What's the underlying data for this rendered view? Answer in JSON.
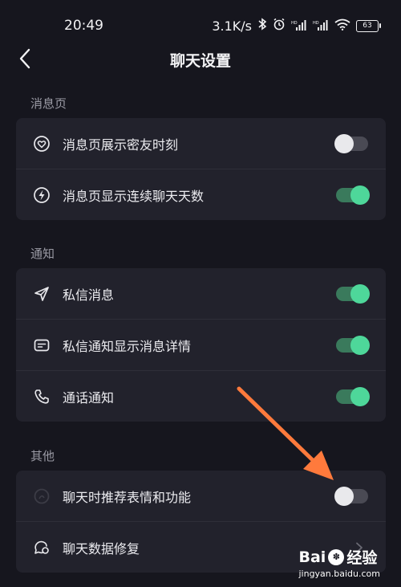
{
  "status_bar": {
    "time": "20:49",
    "network_speed": "3.1K/s",
    "battery_level": "63",
    "icons": [
      "bluetooth-icon",
      "alarm-icon",
      "signal-hd-icon",
      "signal-hd-icon",
      "wifi-icon",
      "battery-icon"
    ]
  },
  "header": {
    "title": "聊天设置",
    "back_icon": "chevron-left-icon"
  },
  "sections": {
    "message_page": {
      "label": "消息页",
      "items": [
        {
          "label": "消息页展示密友时刻",
          "icon": "heart-circle-icon",
          "toggle": "off"
        },
        {
          "label": "消息页显示连续聊天天数",
          "icon": "lightning-circle-icon",
          "toggle": "on"
        }
      ]
    },
    "notifications": {
      "label": "通知",
      "items": [
        {
          "label": "私信消息",
          "icon": "send-icon",
          "toggle": "on"
        },
        {
          "label": "私信通知显示消息详情",
          "icon": "message-card-icon",
          "toggle": "on"
        },
        {
          "label": "通话通知",
          "icon": "phone-icon",
          "toggle": "on"
        }
      ]
    },
    "other": {
      "label": "其他",
      "items": [
        {
          "label": "聊天时推荐表情和功能",
          "icon": "sticker-icon",
          "toggle": "off"
        },
        {
          "label": "聊天数据修复",
          "icon": "chat-repair-icon",
          "action": "chevron-right-icon"
        }
      ]
    }
  },
  "colors": {
    "background": "#16161e",
    "card": "#22222c",
    "toggle_on": "#4ed79a",
    "toggle_off": "#e9e9ec",
    "annotation_arrow": "#ff7a3c"
  },
  "watermark": {
    "logo_left": "Bai",
    "logo_right": "经验",
    "url": "jingyan.baidu.com"
  }
}
